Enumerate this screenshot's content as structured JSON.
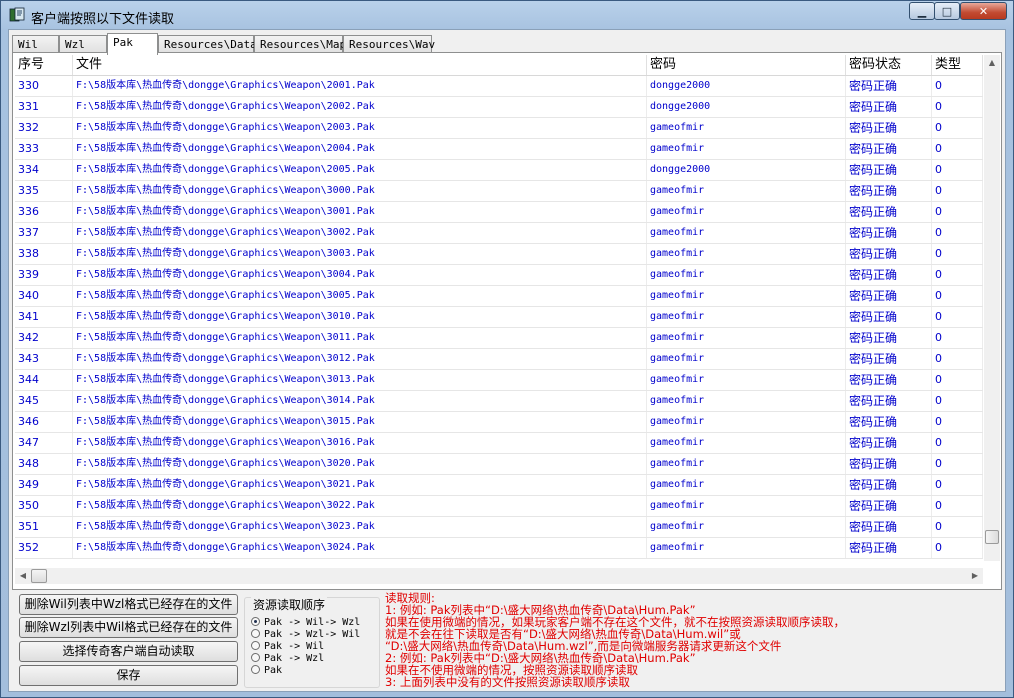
{
  "window": {
    "title": "客户端按照以下文件读取",
    "minimize_glyph": "▁",
    "maximize_glyph": "□",
    "close_glyph": "✕",
    "icon": "app-book-icon"
  },
  "tabs": [
    {
      "label": "Wil",
      "active": false
    },
    {
      "label": "Wzl",
      "active": false
    },
    {
      "label": "Pak",
      "active": true
    },
    {
      "label": "Resources\\Data",
      "active": false
    },
    {
      "label": "Resources\\Map",
      "active": false
    },
    {
      "label": "Resources\\Wav",
      "active": false
    }
  ],
  "table": {
    "columns": [
      "序号",
      "文件",
      "密码",
      "密码状态",
      "类型"
    ],
    "rows": [
      [
        "330",
        "F:\\58版本库\\热血传奇\\dongge\\Graphics\\Weapon\\2001.Pak",
        "dongge2000",
        "密码正确",
        "0"
      ],
      [
        "331",
        "F:\\58版本库\\热血传奇\\dongge\\Graphics\\Weapon\\2002.Pak",
        "dongge2000",
        "密码正确",
        "0"
      ],
      [
        "332",
        "F:\\58版本库\\热血传奇\\dongge\\Graphics\\Weapon\\2003.Pak",
        "gameofmir",
        "密码正确",
        "0"
      ],
      [
        "333",
        "F:\\58版本库\\热血传奇\\dongge\\Graphics\\Weapon\\2004.Pak",
        "gameofmir",
        "密码正确",
        "0"
      ],
      [
        "334",
        "F:\\58版本库\\热血传奇\\dongge\\Graphics\\Weapon\\2005.Pak",
        "dongge2000",
        "密码正确",
        "0"
      ],
      [
        "335",
        "F:\\58版本库\\热血传奇\\dongge\\Graphics\\Weapon\\3000.Pak",
        "gameofmir",
        "密码正确",
        "0"
      ],
      [
        "336",
        "F:\\58版本库\\热血传奇\\dongge\\Graphics\\Weapon\\3001.Pak",
        "gameofmir",
        "密码正确",
        "0"
      ],
      [
        "337",
        "F:\\58版本库\\热血传奇\\dongge\\Graphics\\Weapon\\3002.Pak",
        "gameofmir",
        "密码正确",
        "0"
      ],
      [
        "338",
        "F:\\58版本库\\热血传奇\\dongge\\Graphics\\Weapon\\3003.Pak",
        "gameofmir",
        "密码正确",
        "0"
      ],
      [
        "339",
        "F:\\58版本库\\热血传奇\\dongge\\Graphics\\Weapon\\3004.Pak",
        "gameofmir",
        "密码正确",
        "0"
      ],
      [
        "340",
        "F:\\58版本库\\热血传奇\\dongge\\Graphics\\Weapon\\3005.Pak",
        "gameofmir",
        "密码正确",
        "0"
      ],
      [
        "341",
        "F:\\58版本库\\热血传奇\\dongge\\Graphics\\Weapon\\3010.Pak",
        "gameofmir",
        "密码正确",
        "0"
      ],
      [
        "342",
        "F:\\58版本库\\热血传奇\\dongge\\Graphics\\Weapon\\3011.Pak",
        "gameofmir",
        "密码正确",
        "0"
      ],
      [
        "343",
        "F:\\58版本库\\热血传奇\\dongge\\Graphics\\Weapon\\3012.Pak",
        "gameofmir",
        "密码正确",
        "0"
      ],
      [
        "344",
        "F:\\58版本库\\热血传奇\\dongge\\Graphics\\Weapon\\3013.Pak",
        "gameofmir",
        "密码正确",
        "0"
      ],
      [
        "345",
        "F:\\58版本库\\热血传奇\\dongge\\Graphics\\Weapon\\3014.Pak",
        "gameofmir",
        "密码正确",
        "0"
      ],
      [
        "346",
        "F:\\58版本库\\热血传奇\\dongge\\Graphics\\Weapon\\3015.Pak",
        "gameofmir",
        "密码正确",
        "0"
      ],
      [
        "347",
        "F:\\58版本库\\热血传奇\\dongge\\Graphics\\Weapon\\3016.Pak",
        "gameofmir",
        "密码正确",
        "0"
      ],
      [
        "348",
        "F:\\58版本库\\热血传奇\\dongge\\Graphics\\Weapon\\3020.Pak",
        "gameofmir",
        "密码正确",
        "0"
      ],
      [
        "349",
        "F:\\58版本库\\热血传奇\\dongge\\Graphics\\Weapon\\3021.Pak",
        "gameofmir",
        "密码正确",
        "0"
      ],
      [
        "350",
        "F:\\58版本库\\热血传奇\\dongge\\Graphics\\Weapon\\3022.Pak",
        "gameofmir",
        "密码正确",
        "0"
      ],
      [
        "351",
        "F:\\58版本库\\热血传奇\\dongge\\Graphics\\Weapon\\3023.Pak",
        "gameofmir",
        "密码正确",
        "0"
      ],
      [
        "352",
        "F:\\58版本库\\热血传奇\\dongge\\Graphics\\Weapon\\3024.Pak",
        "gameofmir",
        "密码正确",
        "0"
      ]
    ]
  },
  "buttons": {
    "delete_wil": "删除Wil列表中Wzl格式已经存在的文件",
    "delete_wzl": "删除Wzl列表中Wil格式已经存在的文件",
    "select_client": "选择传奇客户端自动读取",
    "save": "保存"
  },
  "order_group": {
    "title": "资源读取顺序",
    "options": [
      {
        "label": "Pak -> Wil-> Wzl",
        "selected": true
      },
      {
        "label": "Pak -> Wzl-> Wil",
        "selected": false
      },
      {
        "label": "Pak -> Wil",
        "selected": false
      },
      {
        "label": "Pak -> Wzl",
        "selected": false
      },
      {
        "label": "Pak",
        "selected": false
      }
    ]
  },
  "rules": {
    "lines": [
      "读取规则:",
      "1: 例如: Pak列表中“D:\\盛大网络\\热血传奇\\Data\\Hum.Pak”",
      "     如果在使用微端的情况，如果玩家客户端不存在这个文件，就不在按照资源读取顺序读取，",
      "     就是不会在往下读取是否有“D:\\盛大网络\\热血传奇\\Data\\Hum.wil”或",
      "     “D:\\盛大网络\\热血传奇\\Data\\Hum.wzl”,而是向微端服务器请求更新这个文件",
      "2: 例如: Pak列表中“D:\\盛大网络\\热血传奇\\Data\\Hum.Pak”",
      "     如果在不使用微端的情况，按照资源读取顺序读取",
      "3: 上面列表中没有的文件按照资源读取顺序读取"
    ]
  },
  "colors": {
    "row_text": "#0000cc",
    "rules_text": "#e00000"
  }
}
